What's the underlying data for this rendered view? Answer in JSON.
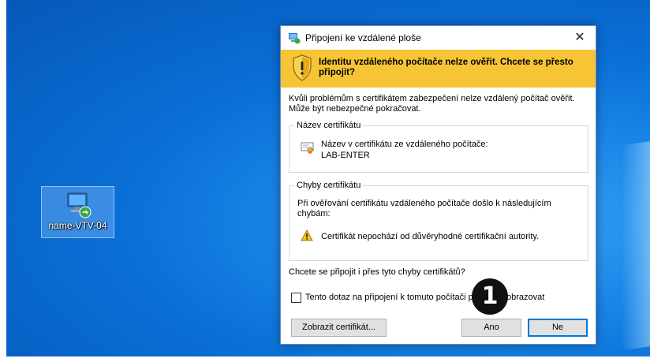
{
  "desktop": {
    "icon_label": "name-VTV-04"
  },
  "dialog": {
    "title": "Připojení ke vzdálené ploše",
    "close_glyph": "✕",
    "warning_banner": "Identitu vzdáleného počítače nelze ověřit. Chcete se přesto připojit?",
    "intro": "Kvůli problémům s certifikátem zabezpečení nelze vzdálený počítač ověřit. Může být nebezpečné pokračovat.",
    "cert_name_group": {
      "legend": "Název certifikátu",
      "label": "Název v certifikátu ze vzdáleného počítače:",
      "value": "LAB-ENTER"
    },
    "cert_errors_group": {
      "legend": "Chyby certifikátu",
      "description": "Při ověřování certifikátu vzdáleného počítače došlo k následujícím chybám:",
      "error": "Certifikát nepochází od důvěryhodné certifikační autority."
    },
    "question": "Chcete se připojit i přes tyto chyby certifikátů?",
    "checkbox_label": "Tento dotaz na připojení k tomuto počítači příště nezobrazovat",
    "checkbox_checked": false,
    "buttons": {
      "view_cert": "Zobrazit certifikát...",
      "yes": "Ano",
      "no": "Ne"
    }
  },
  "annotation": {
    "step_number": "1"
  },
  "colors": {
    "banner": "#f7c436",
    "desktop": "#0a6fd6",
    "default_button_border": "#0078d7"
  },
  "icons": [
    "remote-desktop-icon",
    "shield-warning-icon",
    "certificate-icon",
    "warning-triangle-icon",
    "close-icon"
  ]
}
